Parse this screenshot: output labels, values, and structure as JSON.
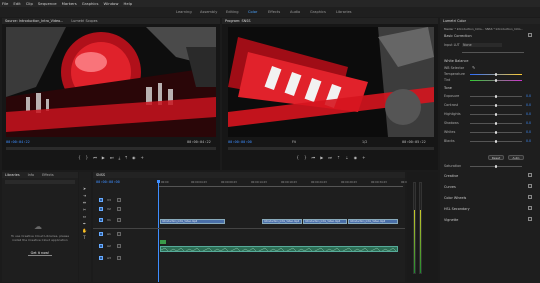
{
  "menu": [
    "File",
    "Edit",
    "Clip",
    "Sequence",
    "Markers",
    "Graphics",
    "Window",
    "Help"
  ],
  "workspaces": [
    "Learning",
    "Assembly",
    "Editing",
    "Color",
    "Effects",
    "Audio",
    "Graphics",
    "Libraries"
  ],
  "active_workspace": "Color",
  "source_panel": {
    "tabs": [
      "Source: Introduction_Intro_Video...",
      "Lumetri Scopes"
    ],
    "timecode_left": "00:00:04:22",
    "timecode_right": "00:00:04:22"
  },
  "program_panel": {
    "tabs": [
      "Program: SNSS"
    ],
    "timecode_left": "00:00:00:00",
    "timecode_right": "00:00:05:22",
    "fit": "Fit",
    "ratio": "1/2"
  },
  "lumetri": {
    "title": "Lumetri Color",
    "header": "Master * Introduction_Intro...   SNSS * Introduction_Intro...",
    "basic_correction": "Basic Correction",
    "input_lut_label": "Input LUT",
    "input_lut_value": "None",
    "white_balance": "White Balance",
    "wb_selector": "WB Selector",
    "temperature": "Temperature",
    "tint": "Tint",
    "tone": "Tone",
    "rows": [
      {
        "label": "Exposure",
        "value": "0.0"
      },
      {
        "label": "Contrast",
        "value": "0.0"
      },
      {
        "label": "Highlights",
        "value": "0.0"
      },
      {
        "label": "Shadows",
        "value": "0.0"
      },
      {
        "label": "Whites",
        "value": "0.0"
      },
      {
        "label": "Blacks",
        "value": "0.0"
      }
    ],
    "reset_label": "Reset",
    "auto_label": "Auto",
    "saturation": "Saturation",
    "sections": [
      "Creative",
      "Curves",
      "Color Wheels",
      "HSL Secondary",
      "Vignette"
    ]
  },
  "project_panel": {
    "tabs": [
      "Libraries",
      "Info",
      "Effects"
    ],
    "message": "To use Creative Cloud Libraries, please install the Creative Cloud application",
    "link": "Get it now!"
  },
  "timeline": {
    "sequence_tab": "SNSS",
    "timecode": "00:00:00:00",
    "ruler": [
      "00:00",
      "00:00:04:23",
      "00:00:09:23",
      "00:00:14:23",
      "00:00:19:23",
      "00:00:24:23",
      "00:00:29:23",
      "00:00:34:23",
      "00:00:39:23"
    ],
    "tracks": [
      "V3",
      "V2",
      "V1",
      "A1",
      "A2",
      "A3"
    ],
    "clips_v": [
      "Introduction_Intro_Video.mp4",
      "Introduction_Intro_Video.mp4",
      "Introduction_Intro_Video.mp4",
      "Introduction_Intro_Video.mp4"
    ]
  },
  "colors": {
    "accent": "#3e8eff",
    "clip_video": "#4a6fa8",
    "clip_audio": "#2d6e55",
    "highlight_red": "#d6141e"
  }
}
